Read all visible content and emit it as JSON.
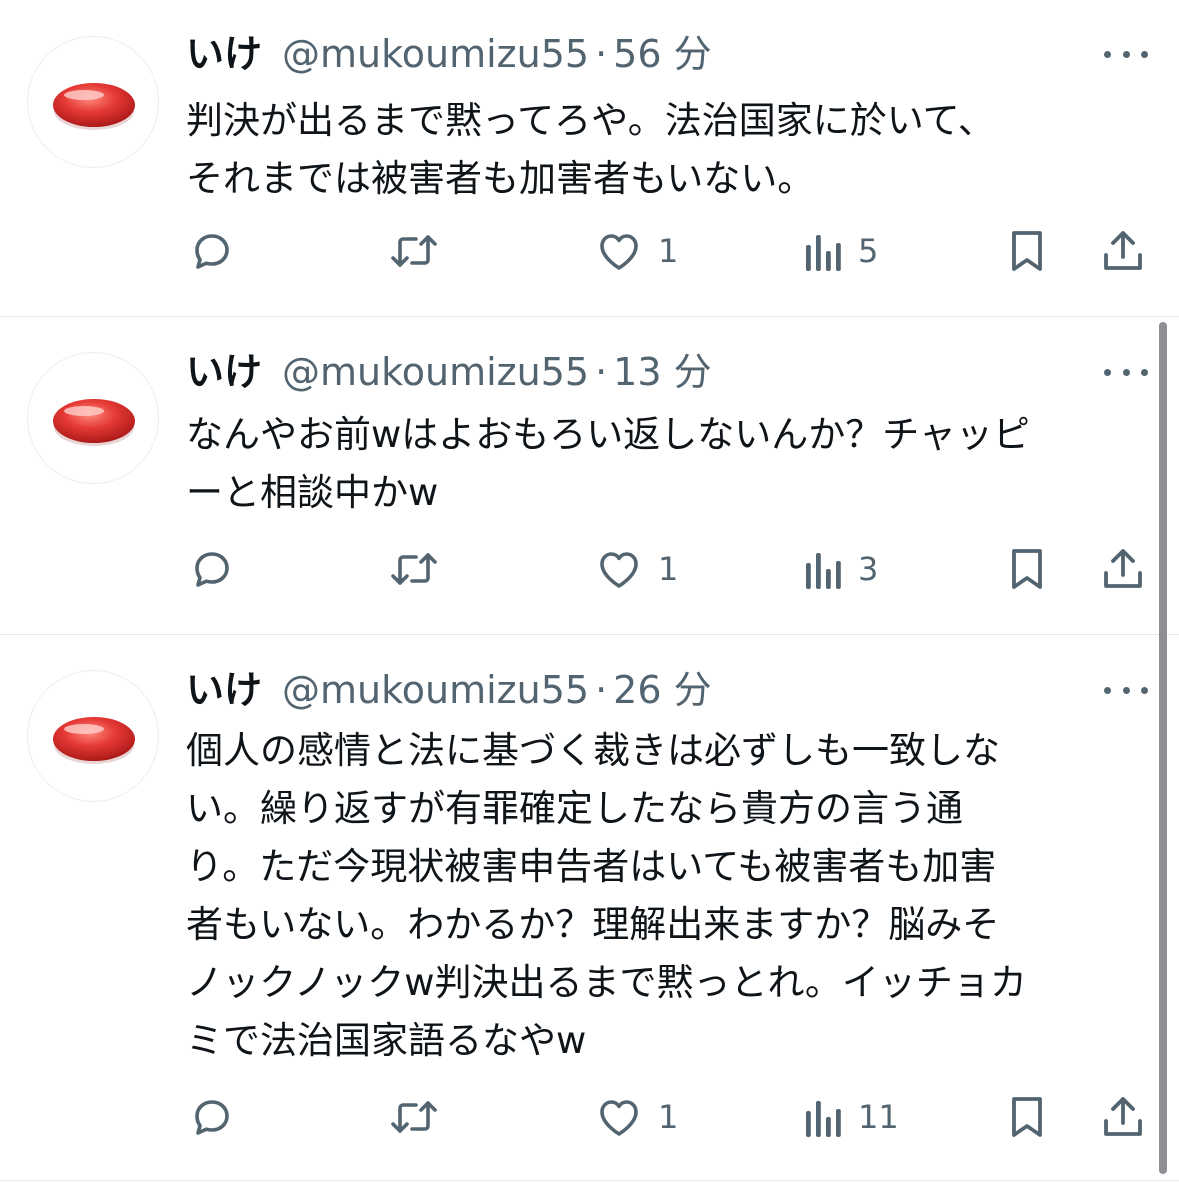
{
  "tweets": [
    {
      "name": "いけ",
      "handle": "@mukoumizu55",
      "separator": "·",
      "time": "56 分",
      "text": "判決が出るまで黙ってろや。法治国家に於いて、\nそれまでは被害者も加害者もいない。",
      "likes": "1",
      "views": "5"
    },
    {
      "name": "いけ",
      "handle": "@mukoumizu55",
      "separator": "·",
      "time": "13 分",
      "text": "なんやお前wはよおもろい返しないんか？チャッピ\nーと相談中かw",
      "likes": "1",
      "views": "3"
    },
    {
      "name": "いけ",
      "handle": "@mukoumizu55",
      "separator": "·",
      "time": "26 分",
      "text": "個人の感情と法に基づく裁きは必ずしも一致しな\nい。繰り返すが有罪確定したなら貴方の言う通\nり。ただ今現状被害申告者はいても被害者も加害\n者もいない。わかるか？理解出来ますか？脳みそ\nノックノックw判決出るまで黙っとれ。イッチョカ\nミで法治国家語るなやw",
      "likes": "1",
      "views": "11"
    }
  ],
  "icons": {
    "reply": "reply-icon",
    "retweet": "retweet-icon",
    "like": "heart-icon",
    "views": "views-icon",
    "bookmark": "bookmark-icon",
    "share": "share-icon",
    "more": "more-icon"
  },
  "colors": {
    "text": "#0f1419",
    "secondary": "#536471",
    "avatar": "#e02a2a"
  }
}
